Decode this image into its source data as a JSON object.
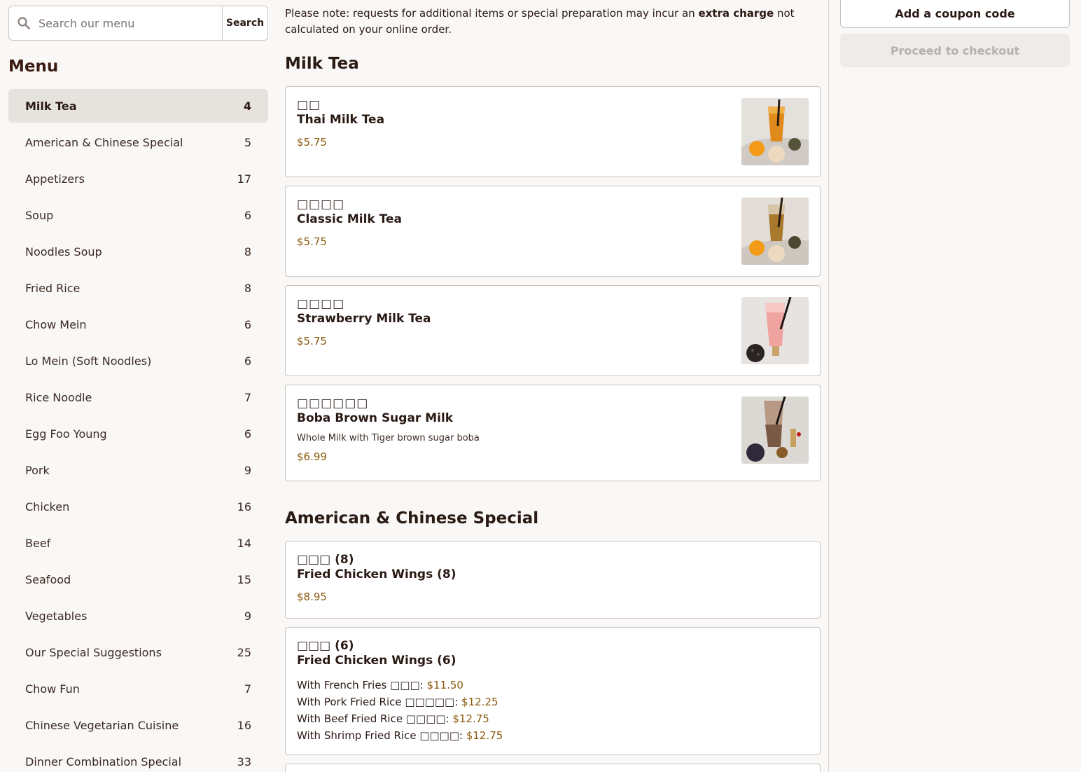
{
  "search": {
    "placeholder": "Search our menu",
    "button_label": "Search"
  },
  "menu": {
    "heading": "Menu",
    "categories": [
      {
        "label": "Milk Tea",
        "count": "4",
        "active": true
      },
      {
        "label": "American & Chinese Special",
        "count": "5"
      },
      {
        "label": "Appetizers",
        "count": "17"
      },
      {
        "label": "Soup",
        "count": "6"
      },
      {
        "label": "Noodles Soup",
        "count": "8"
      },
      {
        "label": "Fried Rice",
        "count": "8"
      },
      {
        "label": "Chow Mein",
        "count": "6"
      },
      {
        "label": "Lo Mein (Soft Noodles)",
        "count": "6"
      },
      {
        "label": "Rice Noodle",
        "count": "7"
      },
      {
        "label": "Egg Foo Young",
        "count": "6"
      },
      {
        "label": "Pork",
        "count": "9"
      },
      {
        "label": "Chicken",
        "count": "16"
      },
      {
        "label": "Beef",
        "count": "14"
      },
      {
        "label": "Seafood",
        "count": "15"
      },
      {
        "label": "Vegetables",
        "count": "9"
      },
      {
        "label": "Our Special Suggestions",
        "count": "25"
      },
      {
        "label": "Chow Fun",
        "count": "7"
      },
      {
        "label": "Chinese Vegetarian Cuisine",
        "count": "16"
      },
      {
        "label": "Dinner Combination Special",
        "count": "33"
      }
    ]
  },
  "notice": {
    "prefix": "Please note: requests for additional items or special preparation may incur an ",
    "emphasis": "extra charge",
    "suffix": " not calculated on your online order."
  },
  "sections": [
    {
      "title": "Milk Tea",
      "items": [
        {
          "cn": "□□",
          "en": "Thai Milk Tea",
          "price": "$5.75",
          "image": "thai-milk-tea"
        },
        {
          "cn": "□□□□",
          "en": "Classic Milk Tea",
          "price": "$5.75",
          "image": "classic-milk-tea"
        },
        {
          "cn": "□□□□",
          "en": "Strawberry Milk Tea",
          "price": "$5.75",
          "image": "strawberry-milk-tea"
        },
        {
          "cn": "□□□□□□",
          "en": "Boba Brown Sugar Milk",
          "description": "Whole Milk with Tiger brown sugar boba",
          "price": "$6.99",
          "image": "boba-brown-sugar-milk"
        }
      ]
    },
    {
      "title": "American & Chinese Special",
      "items": [
        {
          "cn": "□□□ (8)",
          "en": "Fried Chicken Wings (8)",
          "price": "$8.95"
        },
        {
          "cn": "□□□ (6)",
          "en": "Fried Chicken Wings (6)",
          "options": [
            {
              "label": "With French Fries □□□: ",
              "price": "$11.50"
            },
            {
              "label": "With Pork Fried Rice □□□□□: ",
              "price": "$12.25"
            },
            {
              "label": "With Beef Fried Rice □□□□: ",
              "price": "$12.75"
            },
            {
              "label": "With Shrimp Fried Rice □□□□: ",
              "price": "$12.75"
            }
          ]
        }
      ]
    }
  ],
  "cart": {
    "coupon_label": "Add a coupon code",
    "checkout_label": "Proceed to checkout"
  },
  "colors": {
    "price": "#8a5a0c",
    "active_category_bg": "#e6e3df",
    "page_bg": "#faf8f6"
  }
}
